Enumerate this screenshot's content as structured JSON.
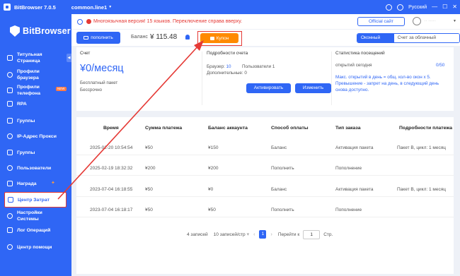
{
  "titlebar": {
    "app_title": "BitBrowser 7.0.5",
    "profile": "common.line1",
    "language": "Русский"
  },
  "sidebar": {
    "brand": "BitBrowser",
    "items": [
      {
        "label_1": "Титульная",
        "label_2": "Страница"
      },
      {
        "label_1": "Профили",
        "label_2": "браузера"
      },
      {
        "label_1": "Профили",
        "label_2": "телефона",
        "badge": "NEW"
      },
      {
        "label_1": "RPA"
      },
      {
        "label_1": "Группы"
      },
      {
        "label_1": "IP-Адрес Прокси"
      },
      {
        "label_1": "Группы"
      },
      {
        "label_1": "Пользователи"
      },
      {
        "label_1": "Награда"
      },
      {
        "label_1": "Центр Затрат"
      },
      {
        "label_1": "Настройки",
        "label_2": "Системы"
      },
      {
        "label_1": "Лог Операций"
      },
      {
        "label_1": "Центр помощи"
      }
    ]
  },
  "notice": {
    "text": "Многоязычная версия! 15 языков. Переключение справа вверху.",
    "official_site": "Official сайт"
  },
  "toolbar": {
    "topup": "пополнить",
    "balance_label": "Баланс",
    "balance_value": "¥ 115.48",
    "coupon": "Купон",
    "seg_on": "Оконный счет",
    "seg_off": "Счет за облачный телефон"
  },
  "account": {
    "title": "Счет",
    "price": "¥0/месяц",
    "plan": "Бесплатный пакет",
    "term": "Бессрочно"
  },
  "details": {
    "title": "Подробности счета",
    "browsers_label": "Браузер:",
    "browsers_value": "10",
    "users": "Пользователи 1",
    "extra": "Дополнительные: 0",
    "activate": "Активировать",
    "change": "Изменить"
  },
  "visits": {
    "title": "Статистика посещений",
    "opened_today": "открытий сегодня",
    "ratio": "0/50",
    "note_1": "Макс. открытий в день = общ. кол-во окон x 5.",
    "note_2": "Превышение - запрет на день, в следующий день",
    "note_3": "снова доступно."
  },
  "table": {
    "columns": [
      "Время",
      "Сумма платежа",
      "Баланс аккаунта",
      "Способ оплаты",
      "Тип заказа",
      "Подробности платежа"
    ],
    "rows": [
      [
        "2025-02-20 10:54:54",
        "¥50",
        "¥150",
        "Баланс",
        "Активация пакета",
        "Пакет B, цикл: 1 месяц"
      ],
      [
        "2025-02-19 18:32:32",
        "¥200",
        "¥200",
        "Пополнить",
        "Пополнение",
        ""
      ],
      [
        "2023-07-04 16:18:55",
        "¥50",
        "¥0",
        "Баланс",
        "Активация пакета",
        "Пакет B, цикл: 1 месяц"
      ],
      [
        "2023-07-04 16:18:17",
        "¥50",
        "¥50",
        "Пополнить",
        "Пополнение",
        ""
      ]
    ]
  },
  "pager": {
    "total": "4 записей",
    "per_page": "10 записей/стр",
    "current": "1",
    "goto_label": "Перейти к",
    "goto_value": "1",
    "suffix": "Стр."
  },
  "colors": {
    "primary": "#2f66f5",
    "coupon": "#ff8a00",
    "highlight": "#e53935"
  }
}
